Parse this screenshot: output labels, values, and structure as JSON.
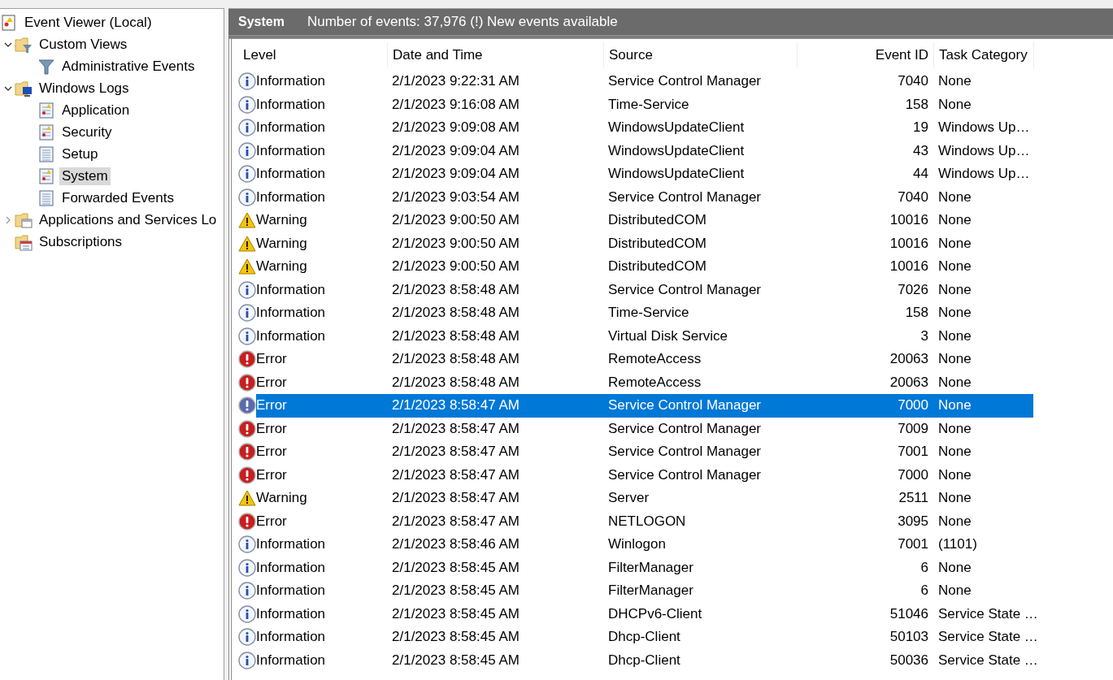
{
  "tree": [
    {
      "label": "Event Viewer (Local)",
      "kind": "root",
      "selected": false,
      "children": [
        {
          "label": "Custom Views",
          "kind": "folder-filter",
          "expanded": true,
          "selected": false,
          "children": [
            {
              "label": "Administrative Events",
              "kind": "filter",
              "selected": false
            }
          ]
        },
        {
          "label": "Windows Logs",
          "kind": "folder-logs",
          "expanded": true,
          "selected": false,
          "children": [
            {
              "label": "Application",
              "kind": "log-alert",
              "selected": false
            },
            {
              "label": "Security",
              "kind": "log-alert",
              "selected": false
            },
            {
              "label": "Setup",
              "kind": "log",
              "selected": false
            },
            {
              "label": "System",
              "kind": "log-alert",
              "selected": true
            },
            {
              "label": "Forwarded Events",
              "kind": "log",
              "selected": false
            }
          ]
        },
        {
          "label": "Applications and Services Lo",
          "kind": "folder-apps",
          "expanded": false,
          "selected": false
        },
        {
          "label": "Subscriptions",
          "kind": "folder-subs",
          "selected": false
        }
      ]
    }
  ],
  "header": {
    "title": "System",
    "info": "Number of events: 37,976 (!) New events available"
  },
  "table": {
    "columns": [
      "Level",
      "Date and Time",
      "Source",
      "Event ID",
      "Task Category"
    ],
    "rows": [
      {
        "kind": "info",
        "level": "Information",
        "date": "2/1/2023 9:22:31 AM",
        "source": "Service Control Manager",
        "event_id": "7040",
        "task": "None",
        "selected": false
      },
      {
        "kind": "info",
        "level": "Information",
        "date": "2/1/2023 9:16:08 AM",
        "source": "Time-Service",
        "event_id": "158",
        "task": "None",
        "selected": false
      },
      {
        "kind": "info",
        "level": "Information",
        "date": "2/1/2023 9:09:08 AM",
        "source": "WindowsUpdateClient",
        "event_id": "19",
        "task": "Windows Up…",
        "selected": false
      },
      {
        "kind": "info",
        "level": "Information",
        "date": "2/1/2023 9:09:04 AM",
        "source": "WindowsUpdateClient",
        "event_id": "43",
        "task": "Windows Up…",
        "selected": false
      },
      {
        "kind": "info",
        "level": "Information",
        "date": "2/1/2023 9:09:04 AM",
        "source": "WindowsUpdateClient",
        "event_id": "44",
        "task": "Windows Up…",
        "selected": false
      },
      {
        "kind": "info",
        "level": "Information",
        "date": "2/1/2023 9:03:54 AM",
        "source": "Service Control Manager",
        "event_id": "7040",
        "task": "None",
        "selected": false
      },
      {
        "kind": "warning",
        "level": "Warning",
        "date": "2/1/2023 9:00:50 AM",
        "source": "DistributedCOM",
        "event_id": "10016",
        "task": "None",
        "selected": false
      },
      {
        "kind": "warning",
        "level": "Warning",
        "date": "2/1/2023 9:00:50 AM",
        "source": "DistributedCOM",
        "event_id": "10016",
        "task": "None",
        "selected": false
      },
      {
        "kind": "warning",
        "level": "Warning",
        "date": "2/1/2023 9:00:50 AM",
        "source": "DistributedCOM",
        "event_id": "10016",
        "task": "None",
        "selected": false
      },
      {
        "kind": "info",
        "level": "Information",
        "date": "2/1/2023 8:58:48 AM",
        "source": "Service Control Manager",
        "event_id": "7026",
        "task": "None",
        "selected": false
      },
      {
        "kind": "info",
        "level": "Information",
        "date": "2/1/2023 8:58:48 AM",
        "source": "Time-Service",
        "event_id": "158",
        "task": "None",
        "selected": false
      },
      {
        "kind": "info",
        "level": "Information",
        "date": "2/1/2023 8:58:48 AM",
        "source": "Virtual Disk Service",
        "event_id": "3",
        "task": "None",
        "selected": false
      },
      {
        "kind": "error",
        "level": "Error",
        "date": "2/1/2023 8:58:48 AM",
        "source": "RemoteAccess",
        "event_id": "20063",
        "task": "None",
        "selected": false
      },
      {
        "kind": "error",
        "level": "Error",
        "date": "2/1/2023 8:58:48 AM",
        "source": "RemoteAccess",
        "event_id": "20063",
        "task": "None",
        "selected": false
      },
      {
        "kind": "error",
        "level": "Error",
        "date": "2/1/2023 8:58:47 AM",
        "source": "Service Control Manager",
        "event_id": "7000",
        "task": "None",
        "selected": true
      },
      {
        "kind": "error",
        "level": "Error",
        "date": "2/1/2023 8:58:47 AM",
        "source": "Service Control Manager",
        "event_id": "7009",
        "task": "None",
        "selected": false
      },
      {
        "kind": "error",
        "level": "Error",
        "date": "2/1/2023 8:58:47 AM",
        "source": "Service Control Manager",
        "event_id": "7001",
        "task": "None",
        "selected": false
      },
      {
        "kind": "error",
        "level": "Error",
        "date": "2/1/2023 8:58:47 AM",
        "source": "Service Control Manager",
        "event_id": "7000",
        "task": "None",
        "selected": false
      },
      {
        "kind": "warning",
        "level": "Warning",
        "date": "2/1/2023 8:58:47 AM",
        "source": "Server",
        "event_id": "2511",
        "task": "None",
        "selected": false
      },
      {
        "kind": "error",
        "level": "Error",
        "date": "2/1/2023 8:58:47 AM",
        "source": "NETLOGON",
        "event_id": "3095",
        "task": "None",
        "selected": false
      },
      {
        "kind": "info",
        "level": "Information",
        "date": "2/1/2023 8:58:46 AM",
        "source": "Winlogon",
        "event_id": "7001",
        "task": "(1101)",
        "selected": false
      },
      {
        "kind": "info",
        "level": "Information",
        "date": "2/1/2023 8:58:45 AM",
        "source": "FilterManager",
        "event_id": "6",
        "task": "None",
        "selected": false
      },
      {
        "kind": "info",
        "level": "Information",
        "date": "2/1/2023 8:58:45 AM",
        "source": "FilterManager",
        "event_id": "6",
        "task": "None",
        "selected": false
      },
      {
        "kind": "info",
        "level": "Information",
        "date": "2/1/2023 8:58:45 AM",
        "source": "DHCPv6-Client",
        "event_id": "51046",
        "task": "Service State …",
        "selected": false
      },
      {
        "kind": "info",
        "level": "Information",
        "date": "2/1/2023 8:58:45 AM",
        "source": "Dhcp-Client",
        "event_id": "50103",
        "task": "Service State …",
        "selected": false
      },
      {
        "kind": "info",
        "level": "Information",
        "date": "2/1/2023 8:58:45 AM",
        "source": "Dhcp-Client",
        "event_id": "50036",
        "task": "Service State …",
        "selected": false
      }
    ]
  }
}
